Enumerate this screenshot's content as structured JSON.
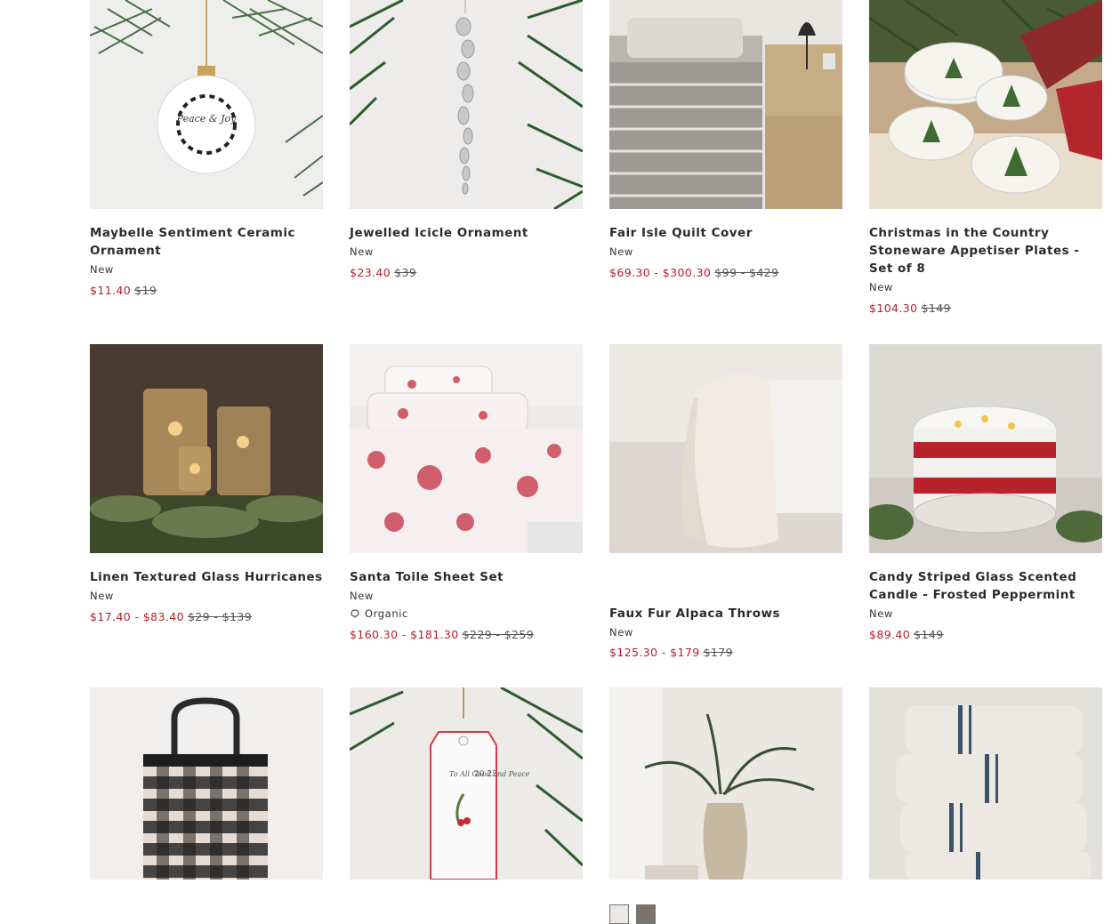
{
  "products": [
    {
      "title": "Maybelle Sentiment Ceramic Ornament",
      "badge": "New",
      "sale": "$11.40",
      "was": "$19"
    },
    {
      "title": "Jewelled Icicle Ornament",
      "badge": "New",
      "sale": "$23.40",
      "was": "$39"
    },
    {
      "title": "Fair Isle Quilt Cover",
      "badge": "New",
      "sale": "$69.30 - $300.30",
      "was": "$99 - $429"
    },
    {
      "title": "Christmas in the Country Stoneware Appetiser Plates - Set of 8",
      "badge": "New",
      "sale": "$104.30",
      "was": "$149"
    },
    {
      "title": "Linen Textured Glass Hurricanes",
      "badge": "New",
      "sale": "$17.40 - $83.40",
      "was": "$29 - $139"
    },
    {
      "title": "Santa Toile Sheet Set",
      "badge": "New",
      "organic": "Organic",
      "sale": "$160.30 - $181.30",
      "was": "$229 - $259"
    },
    {
      "title": "Faux Fur Alpaca Throws",
      "badge": "New",
      "sale": "$125.30 - $179",
      "was": "$179"
    },
    {
      "title": "Candy Striped Glass Scented Candle - Frosted Peppermint",
      "badge": "New",
      "sale": "$89.40",
      "was": "$149"
    }
  ],
  "image_ornament_text": "Peace & Joy",
  "image_tag_text": "To All Good and Peace",
  "image_tag_year": "20 25",
  "colors": {
    "sale": "#b5202a",
    "text": "#2b2b2b"
  }
}
